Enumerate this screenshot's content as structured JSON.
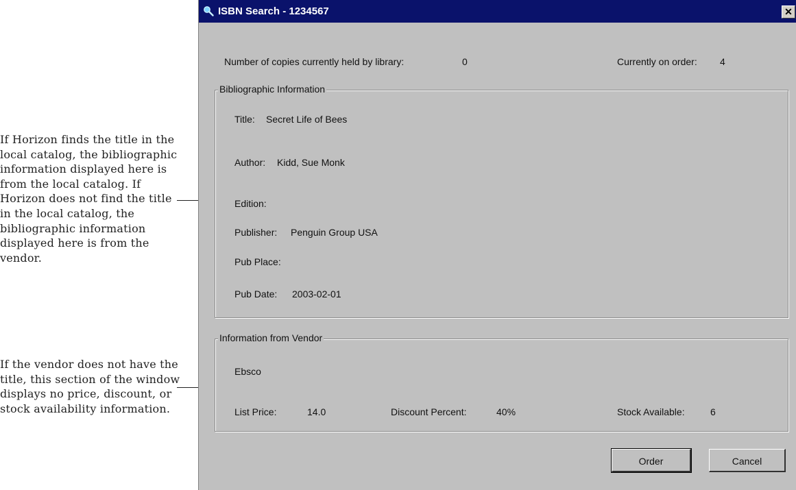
{
  "annotations": {
    "bibliographic": "If Horizon finds the title in the local catalog, the bibliographic information displayed here is from the local catalog. If Horizon does not find the title in the local catalog, the bibliographic information displayed here is from the vendor.",
    "vendor": "If the vendor does not have the title, this section of the window displays no price, discount, or stock availability information."
  },
  "window": {
    "title": "ISBN Search - 1234567",
    "close_label": "✕",
    "copies_held_label": "Number of copies currently held by library:",
    "copies_held_value": "0",
    "on_order_label": "Currently on order:",
    "on_order_value": "4"
  },
  "bibliographic": {
    "legend": "Bibliographic Information",
    "title_label": "Title:",
    "title_value": "Secret Life of Bees",
    "author_label": "Author:",
    "author_value": "Kidd, Sue Monk",
    "edition_label": "Edition:",
    "publisher_label": "Publisher:",
    "publisher_value": "Penguin Group USA",
    "pub_place_label": "Pub Place:",
    "pub_date_label": "Pub Date:",
    "pub_date_value": "2003-02-01"
  },
  "vendor": {
    "legend": "Information from Vendor",
    "name": "Ebsco",
    "list_price_label": "List Price:",
    "list_price_value": "14.0",
    "discount_label": "Discount Percent:",
    "discount_value": "40%",
    "stock_label": "Stock Available:",
    "stock_value": "6"
  },
  "buttons": {
    "order": "Order",
    "cancel": "Cancel"
  }
}
